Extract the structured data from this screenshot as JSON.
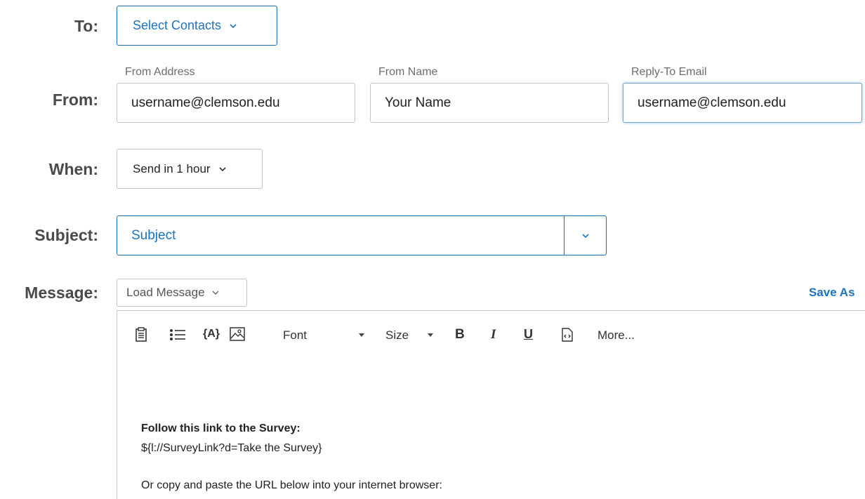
{
  "to": {
    "label": "To:",
    "button": "Select Contacts"
  },
  "from": {
    "label": "From:",
    "from_address": {
      "caption": "From Address",
      "value": "username@clemson.edu"
    },
    "from_name": {
      "caption": "From Name",
      "value": "Your Name"
    },
    "reply_to": {
      "caption": "Reply-To Email",
      "value": "username@clemson.edu"
    }
  },
  "when": {
    "label": "When:",
    "value": "Send in 1 hour"
  },
  "subject": {
    "label": "Subject:",
    "value": "Subject"
  },
  "message": {
    "label": "Message:",
    "load_button": "Load Message",
    "save_as": "Save As",
    "toolbar": {
      "font": "Font",
      "size": "Size",
      "bold": "B",
      "italic": "I",
      "underline": "U",
      "more": "More..."
    },
    "body": {
      "heading": "Follow this link to the Survey:",
      "link": "${l://SurveyLink?d=Take the Survey}",
      "partial_line": "Or copy and paste the URL below into your internet browser:"
    }
  },
  "colors": {
    "accent": "#1e73be",
    "border": "#c4c4c4"
  },
  "icons": [
    "clipboard-icon",
    "list-icon",
    "piped-text-icon",
    "image-icon",
    "caret-down-icon",
    "source-code-icon",
    "chevron-down-icon"
  ]
}
